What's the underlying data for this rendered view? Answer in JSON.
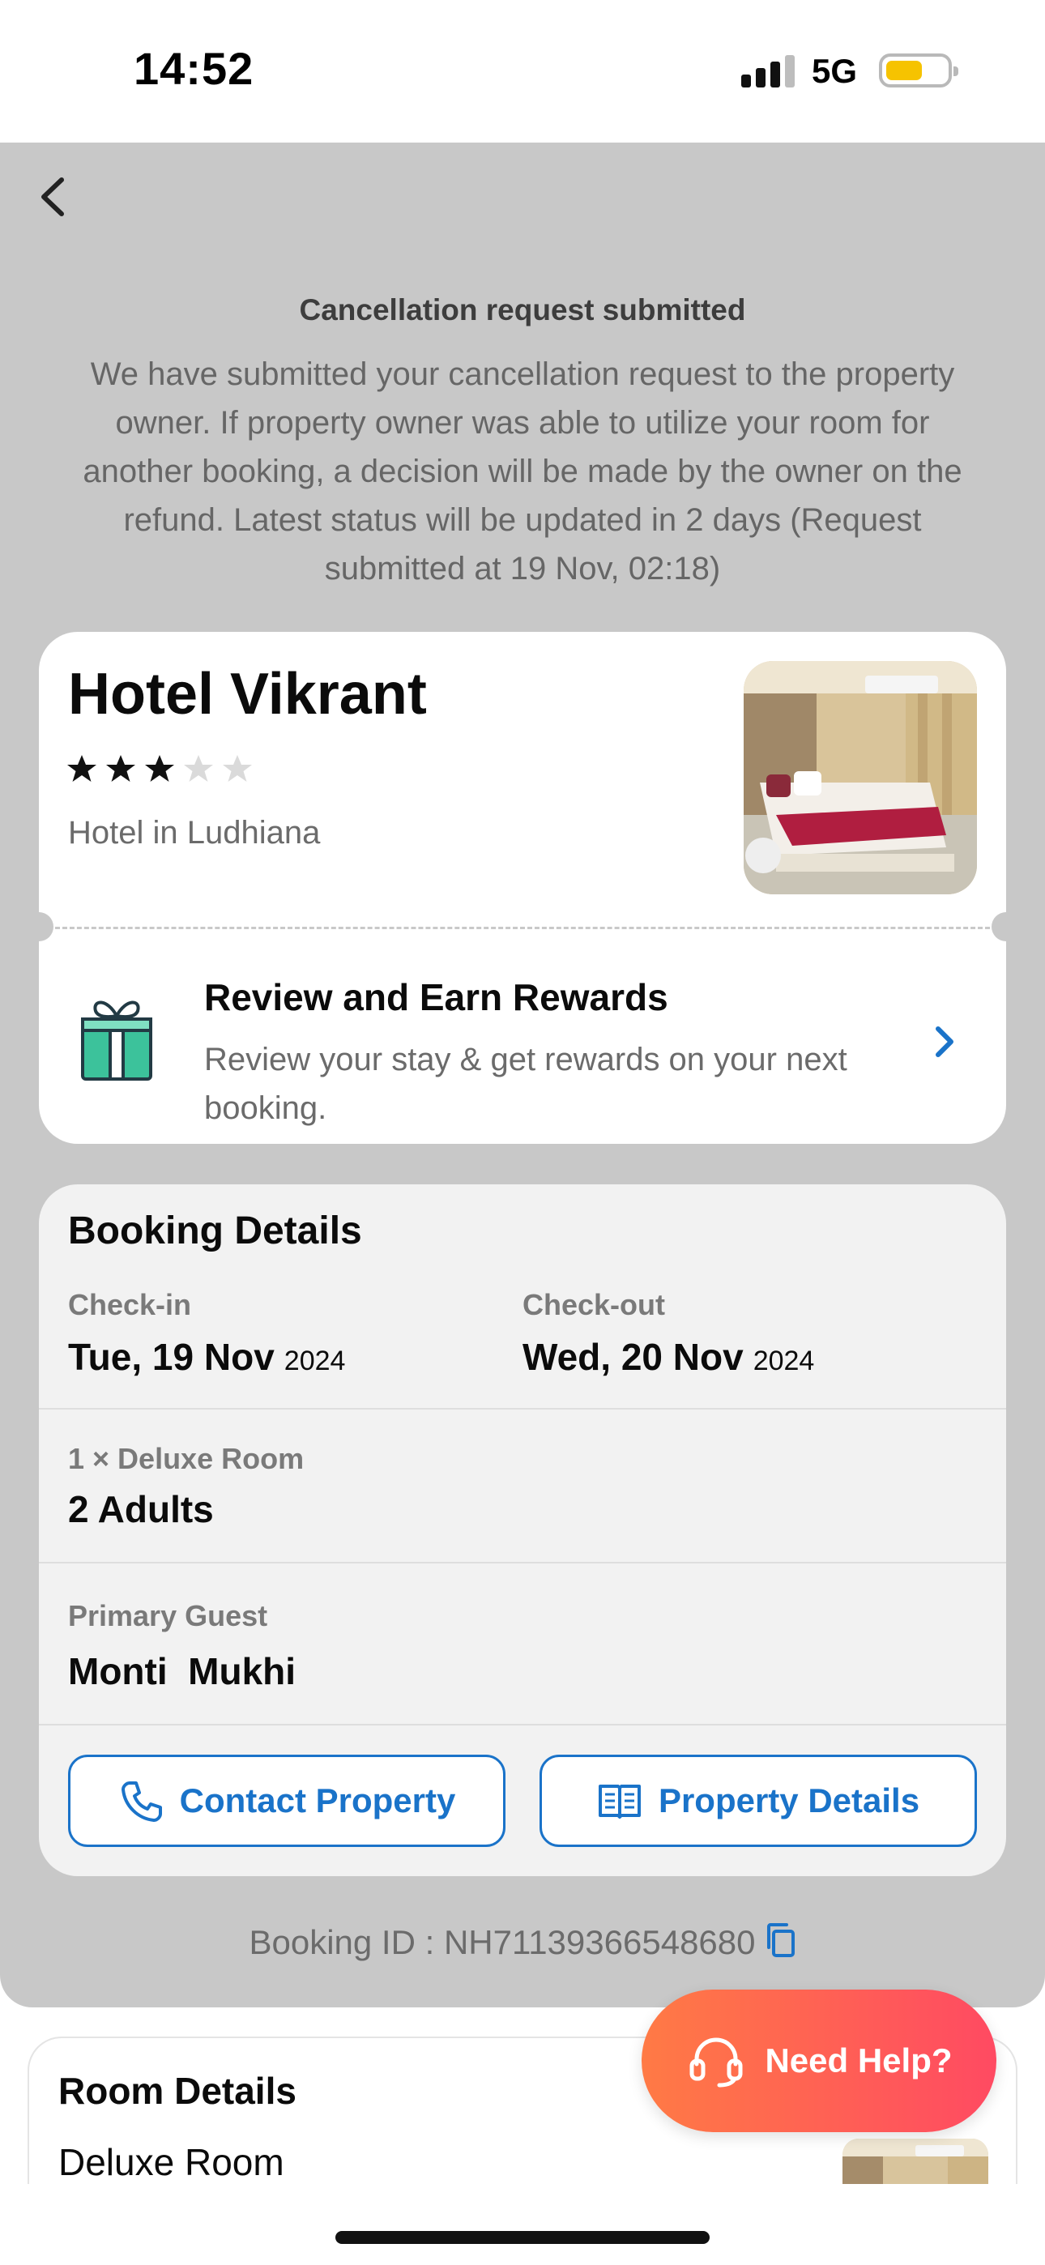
{
  "status_bar": {
    "time": "14:52",
    "network": "5G",
    "battery_level": 0.6,
    "battery_color": "#f6c300"
  },
  "header": {
    "back_icon": "chevron-left-icon"
  },
  "notice": {
    "title": "Cancellation request submitted",
    "body": "We have submitted your cancellation request to the property owner. If property owner was able to utilize your room for another booking, a decision will be made by the owner on the refund. Latest status will be updated in 2 days (Request submitted at 19 Nov, 02:18)"
  },
  "hotel": {
    "name": "Hotel Vikrant",
    "rating": 3,
    "rating_max": 5,
    "location": "Hotel in Ludhiana",
    "photo_icon": "hotel-room-photo"
  },
  "review": {
    "title": "Review and Earn Rewards",
    "subtitle": "Review your stay & get rewards on your next booking.",
    "icon": "gift-icon",
    "accent": "#1a73c9"
  },
  "booking": {
    "title": "Booking Details",
    "checkin_label": "Check-in",
    "checkin_date": "Tue, 19 Nov",
    "checkin_year": "2024",
    "checkout_label": "Check-out",
    "checkout_date": "Wed, 20 Nov",
    "checkout_year": "2024",
    "room_label": "1 × Deluxe Room",
    "guests": "2 Adults",
    "guest_label": "Primary Guest",
    "guest_name": "Monti  Mukhi",
    "contact_button": "Contact Property",
    "details_button": "Property Details"
  },
  "booking_id": {
    "text": "Booking ID : NH71139366548680",
    "copy_icon": "copy-icon"
  },
  "room_details": {
    "title": "Room Details",
    "room_name": "Deluxe Room"
  },
  "help": {
    "label": "Need Help?",
    "icon": "headset-icon",
    "gradient_start": "#ff7a45",
    "gradient_end": "#ff4a62"
  }
}
